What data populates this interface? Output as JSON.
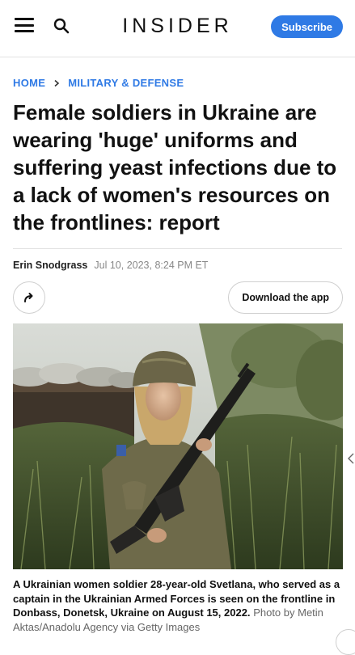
{
  "header": {
    "logo": "INSIDER",
    "subscribe_label": "Subscribe",
    "menu_icon": "hamburger-menu-icon",
    "search_icon": "search-icon"
  },
  "breadcrumb": {
    "home": "HOME",
    "section": "MILITARY & DEFENSE"
  },
  "article": {
    "headline": "Female soldiers in Ukraine are wearing 'huge' uniforms and suffering yeast infections due to a lack of women's resources on the frontlines: report",
    "author": "Erin Snodgrass",
    "date": "Jul 10, 2023, 8:24 PM ET",
    "download_app_label": "Download the app",
    "share_icon": "share-arrow-icon",
    "caption": {
      "text": "A Ukrainian women soldier 28-year-old Svetlana, who served as a captain in the Ukrainian Armed Forces is seen on the frontline in Donbass, Donetsk, Ukraine on August 15, 2022.",
      "credit": "Photo by Metin Aktas/Anadolu Agency via Getty Images"
    }
  },
  "colors": {
    "accent": "#2f7ae5",
    "text": "#111111",
    "muted": "#888888"
  }
}
